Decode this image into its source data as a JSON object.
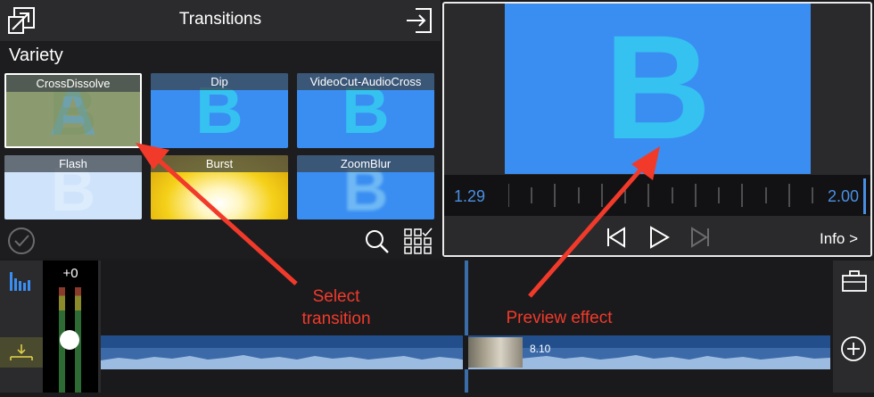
{
  "transitions_panel": {
    "title": "Transitions",
    "category": "Variety",
    "items": [
      {
        "label": "CrossDissolve",
        "selected": true
      },
      {
        "label": "Dip",
        "selected": false
      },
      {
        "label": "VideoCut-AudioCross",
        "selected": false
      },
      {
        "label": "Flash",
        "selected": false
      },
      {
        "label": "Burst",
        "selected": false
      },
      {
        "label": "ZoomBlur",
        "selected": false
      }
    ],
    "thumb_letters": {
      "a": "A",
      "b": "B"
    }
  },
  "preview": {
    "letter": "B",
    "start_time": "1.29",
    "end_time": "2.00",
    "info_label": "Info >"
  },
  "timeline": {
    "volume_label": "+0",
    "clip_duration": "8.10"
  },
  "annotations": {
    "select": "Select\ntransition",
    "preview": "Preview effect"
  },
  "colors": {
    "accent_blue": "#3a8ef2",
    "annotation_red": "#f23a2b",
    "timecode_blue": "#4a90e2"
  }
}
